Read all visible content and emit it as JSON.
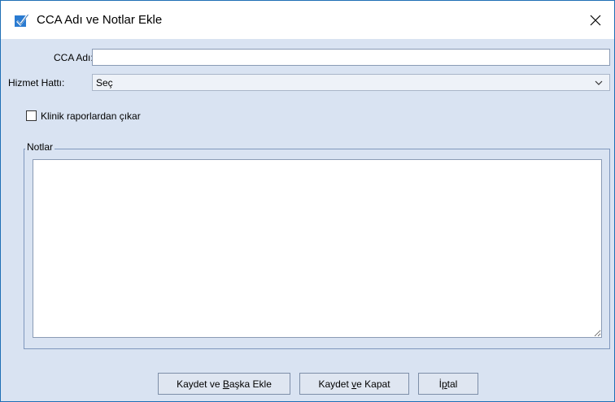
{
  "window": {
    "title": "CCA Adı ve Notlar Ekle"
  },
  "form": {
    "cca_label": "CCA Adı:",
    "cca_value": "",
    "service_label": "Hizmet Hattı:",
    "service_value": "Seç",
    "exclude_label": "Klinik raporlardan çıkar",
    "exclude_checked": false,
    "notes_label": "Notlar",
    "notes_value": ""
  },
  "buttons": {
    "save_add": {
      "pre": "Kaydet ve ",
      "mn": "B",
      "post": "aşka Ekle"
    },
    "save_close": {
      "pre": "Kaydet ",
      "mn": "v",
      "post": "e Kapat"
    },
    "cancel": {
      "pre": "İ",
      "mn": "p",
      "post": "tal"
    }
  },
  "colors": {
    "accent": "#1f6fb5",
    "background": "#d9e3f2"
  },
  "icons": {
    "title": "checkbox-check-icon",
    "close": "close-icon",
    "dropdown": "chevron-down-icon"
  }
}
